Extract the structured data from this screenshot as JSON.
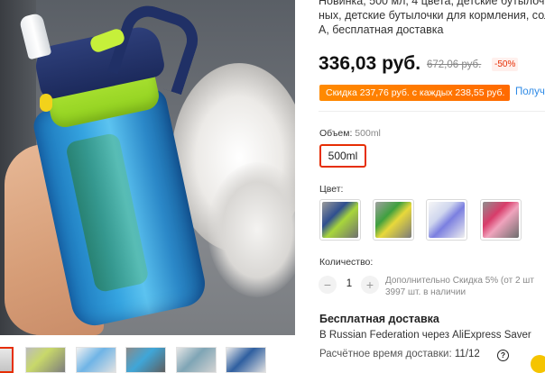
{
  "product": {
    "title_lines": [
      "Новинка, 500 мл, 4 цвета, детские бутылочки",
      "ных, детские бутылочки для кормления, сол",
      "А, бесплатная доставка"
    ],
    "price": "336,03 руб.",
    "old_price": "672,06 руб.",
    "discount": "-50%",
    "promo": "Скидка 237,76 руб. с каждых 238,55 руб.",
    "promo_more": "Получить"
  },
  "volume": {
    "label": "Объем:",
    "selected": "500ml",
    "options": [
      "500ml"
    ]
  },
  "color": {
    "label": "Цвет:",
    "options": [
      "navy-green",
      "green-yellow",
      "purple",
      "pink"
    ]
  },
  "quantity": {
    "label": "Количество:",
    "minus": "−",
    "value": "1",
    "plus": "+",
    "info_line1": "Дополнительно Скидка 5% (от 2 шт",
    "info_line2": "3997 шт. в наличии"
  },
  "shipping": {
    "title": "Бесплатная доставка",
    "line": "В Russian Federation через AliExpress Saver",
    "eta_label": "Расчётное время доставки:",
    "eta_value": "11/12",
    "help_icon": "?"
  },
  "gallery": {
    "thumb_count": 6,
    "active_index": 0
  },
  "colors": {
    "accent": "#e62e04",
    "promo": "#ff7a00",
    "link": "#2e8ae6"
  }
}
